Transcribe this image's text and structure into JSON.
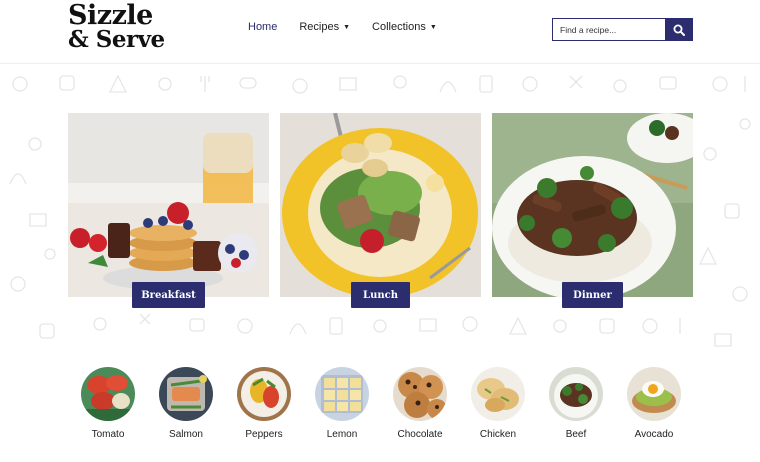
{
  "brand": {
    "line1": "Sizzle",
    "line2": "& Serve"
  },
  "nav": {
    "home": "Home",
    "recipes": "Recipes",
    "collections": "Collections"
  },
  "search": {
    "placeholder": "Find a recipe..."
  },
  "meals": [
    {
      "label": "Breakfast"
    },
    {
      "label": "Lunch"
    },
    {
      "label": "Dinner"
    }
  ],
  "ingredients": [
    {
      "label": "Tomato"
    },
    {
      "label": "Salmon"
    },
    {
      "label": "Peppers"
    },
    {
      "label": "Lemon"
    },
    {
      "label": "Chocolate"
    },
    {
      "label": "Chicken"
    },
    {
      "label": "Beef"
    },
    {
      "label": "Avocado"
    }
  ],
  "colors": {
    "accent": "#2b2d6e"
  }
}
